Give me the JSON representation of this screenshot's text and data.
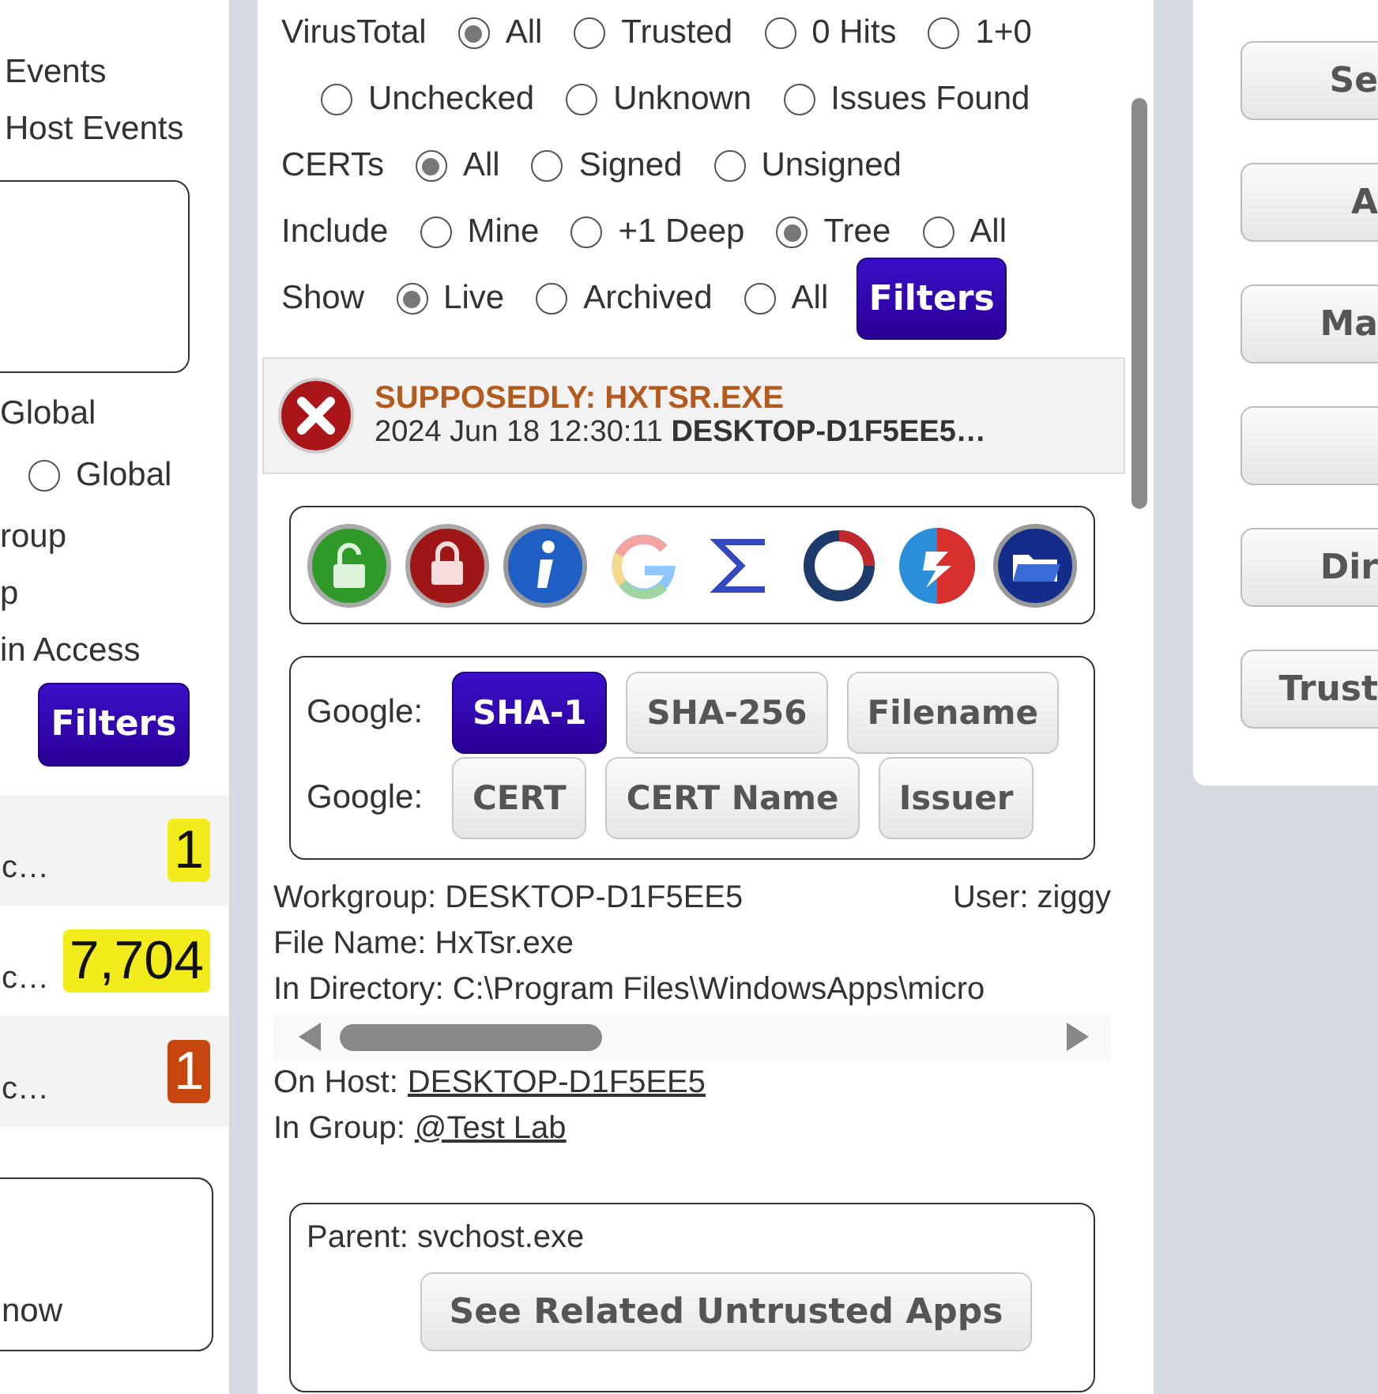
{
  "left_panel": {
    "links": [
      "Events",
      "Host Events"
    ],
    "scope_label": "Global",
    "scope_radio": {
      "label": "Global",
      "selected": false
    },
    "options": [
      "roup",
      "p",
      "in Access"
    ],
    "filters_button": "Filters",
    "counts": [
      {
        "label": "c…",
        "count": "1",
        "color": "#f3ec1c"
      },
      {
        "label": "c…",
        "count": "7,704",
        "color": "#f3ec1c"
      },
      {
        "label": "c…",
        "count": "1",
        "color": "#c5460e"
      }
    ],
    "bottom_text": "now"
  },
  "filters": {
    "groups": [
      {
        "label": "VirusTotal",
        "lines": [
          [
            {
              "label": "All",
              "selected": true
            },
            {
              "label": "Trusted",
              "selected": false
            },
            {
              "label": "0 Hits",
              "selected": false
            },
            {
              "label": "1+0",
              "selected": false
            }
          ],
          [
            {
              "label": "Unchecked",
              "selected": false
            },
            {
              "label": "Unknown",
              "selected": false
            },
            {
              "label": "Issues Found",
              "selected": false
            }
          ]
        ]
      },
      {
        "label": "CERTs",
        "lines": [
          [
            {
              "label": "All",
              "selected": true
            },
            {
              "label": "Signed",
              "selected": false
            },
            {
              "label": "Unsigned",
              "selected": false
            }
          ]
        ]
      },
      {
        "label": "Include",
        "lines": [
          [
            {
              "label": "Mine",
              "selected": false
            },
            {
              "label": "+1 Deep",
              "selected": false
            },
            {
              "label": "Tree",
              "selected": true
            },
            {
              "label": "All",
              "selected": false
            }
          ]
        ]
      },
      {
        "label": "Show",
        "lines": [
          [
            {
              "label": "Live",
              "selected": true
            },
            {
              "label": "Archived",
              "selected": false
            },
            {
              "label": "All",
              "selected": false
            }
          ]
        ]
      }
    ],
    "filters_button": "Filters"
  },
  "alert": {
    "title": "SUPPOSEDLY: HXTSR.EXE",
    "subtitle": "2024 Jun 18 12:30:11 **DESKTOP-D1F5EE5…**"
  },
  "google_search": {
    "rows": [
      {
        "label": "Google:",
        "buttons": [
          {
            "label": "SHA-1",
            "selected": true
          },
          {
            "label": "SHA-256",
            "selected": false
          },
          {
            "label": "Filename",
            "selected": false
          }
        ]
      },
      {
        "label": "Google:",
        "buttons": [
          {
            "label": "CERT",
            "selected": false
          },
          {
            "label": "CERT Name",
            "selected": false
          },
          {
            "label": "Issuer",
            "selected": false
          }
        ]
      }
    ]
  },
  "details": {
    "workgroup": "Workgroup: DESKTOP-D1F5EE5",
    "user": "User: ziggy",
    "file_name": "File Name: HxTsr.exe",
    "directory": "In Directory: C:\\Program Files\\WindowsApps\\micro",
    "host_label": "On Host:",
    "host_link": "DESKTOP-D1F5EE5",
    "group_label": "In Group:",
    "group_link": "@Test Lab"
  },
  "parent": {
    "text": "Parent: svchost.exe",
    "button": "See Related Untrusted Apps"
  },
  "right_panel": {
    "buttons": [
      {
        "kind": "labeled",
        "label": "Se"
      },
      {
        "kind": "labeled",
        "label": "A"
      },
      {
        "kind": "labeled",
        "label": "Ma"
      },
      {
        "kind": "blank"
      },
      {
        "kind": "labeled",
        "label": "Dir"
      },
      {
        "kind": "labeled",
        "label": "Trust"
      }
    ]
  }
}
